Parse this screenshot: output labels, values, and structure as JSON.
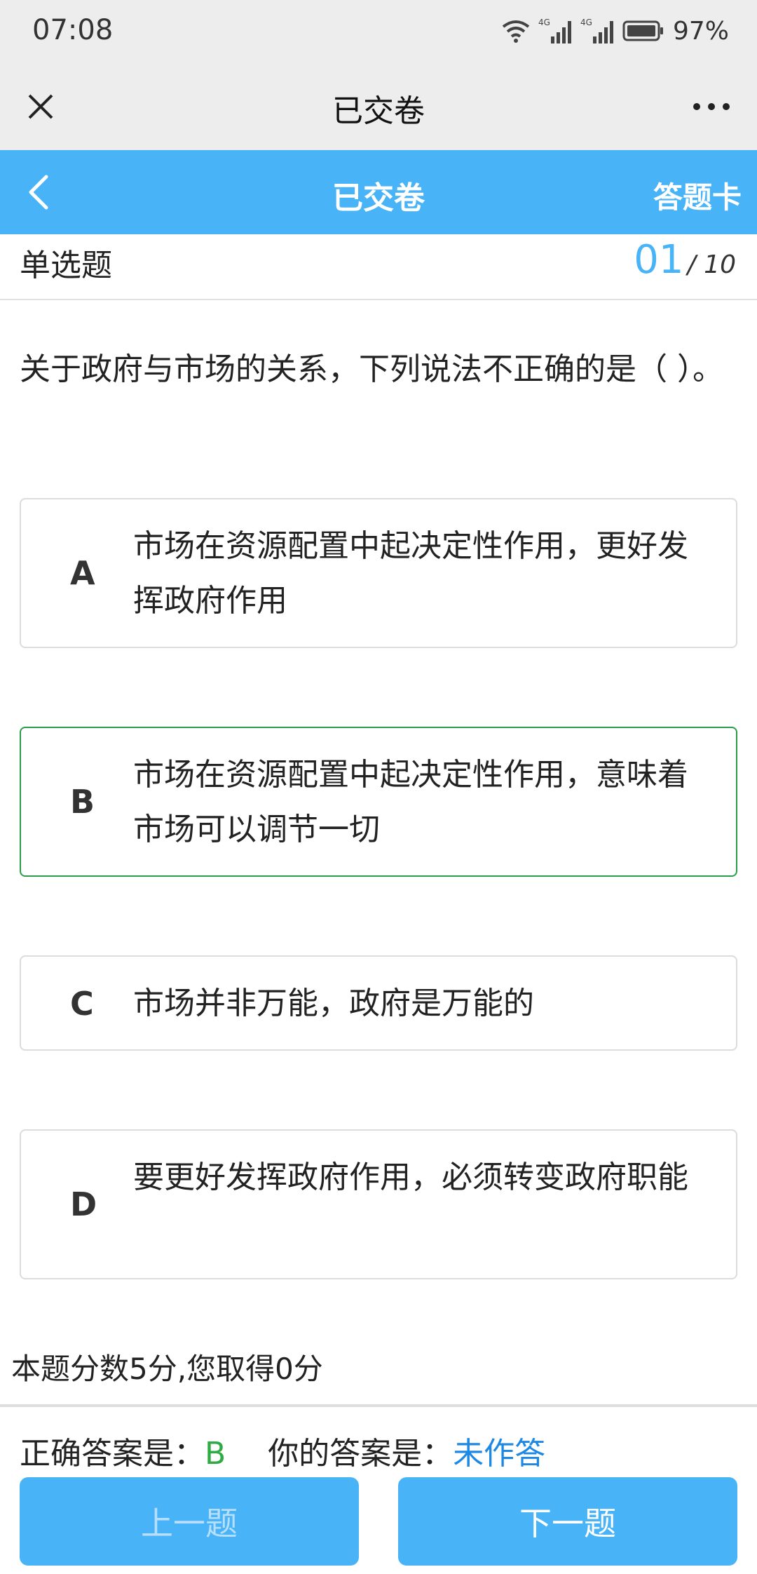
{
  "status_bar": {
    "time": "07:08",
    "battery": "97%",
    "network_1": "4G",
    "network_2": "4G"
  },
  "wechat_bar": {
    "title": "已交卷"
  },
  "app_bar": {
    "title": "已交卷",
    "answer_card_label": "答题卡"
  },
  "question_header": {
    "type": "单选题",
    "current": "01",
    "total": "/ 10"
  },
  "question": {
    "text": "关于政府与市场的关系，下列说法不正确的是（ ）。"
  },
  "options": [
    {
      "letter": "A",
      "text": "市场在资源配置中起决定性作用，更好发挥政府作用"
    },
    {
      "letter": "B",
      "text": "市场在资源配置中起决定性作用，意味着市场可以调节一切"
    },
    {
      "letter": "C",
      "text": "市场并非万能，政府是万能的"
    },
    {
      "letter": "D",
      "text": "要更好发挥政府作用，必须转变政府职能"
    }
  ],
  "result": {
    "score_text": "本题分数5分,您取得0分",
    "correct_label": "正确答案是：",
    "correct_value": "B",
    "yours_label": "你的答案是：",
    "yours_value": "未作答"
  },
  "nav": {
    "prev_label": "上一题",
    "next_label": "下一题"
  },
  "colors": {
    "accent": "#48b4f7",
    "correct": "#2fab44",
    "correct_border": "#2a9d4a",
    "your_answer": "#1e88e5"
  }
}
